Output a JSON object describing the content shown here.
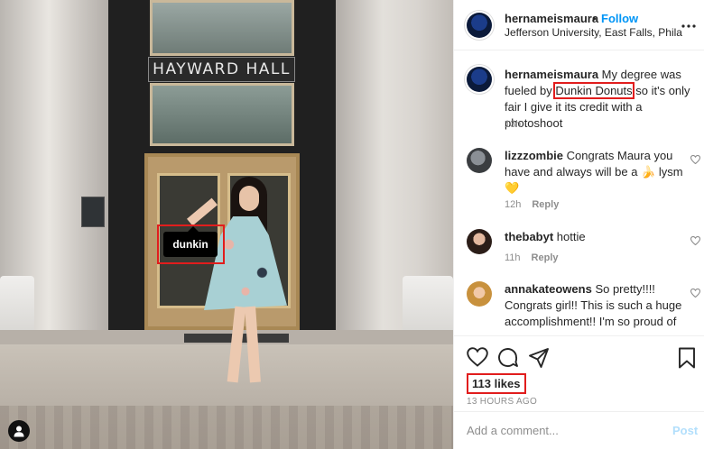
{
  "photo": {
    "building_sign": "HAYWARD HALL",
    "tag_label": "dunkin"
  },
  "header": {
    "username": "hernameismaura",
    "separator": "•",
    "follow_label": "Follow",
    "location": "Jefferson University, East Falls, Phila",
    "more_icon": "more-horizontal-icon"
  },
  "comments": [
    {
      "username": "hernameismaura",
      "text_before": " My degree was fueled by ",
      "mention": "Dunkin Donuts",
      "text_after": " so it's only fair I give it its credit with a photoshoot",
      "time": "13h"
    },
    {
      "username": "lizzzombie",
      "text": " Congrats Maura you have and always will be a 🍌 lysm 💛",
      "time": "12h",
      "reply": "Reply"
    },
    {
      "username": "thebabyt",
      "text": " hottie",
      "time": "11h",
      "reply": "Reply"
    },
    {
      "username": "annakateowens",
      "text": " So pretty!!!! Congrats girl!! This is such a huge accomplishment!! I'm so proud of you!!",
      "time": "",
      "reply": ""
    }
  ],
  "actions": {
    "likes": "113 likes",
    "posted_ago": "13 HOURS AGO",
    "icons": [
      "heart-icon",
      "comment-icon",
      "share-icon",
      "bookmark-icon"
    ]
  },
  "add_comment": {
    "placeholder": "Add a comment...",
    "post_label": "Post"
  },
  "colors": {
    "accent_blue": "#0095f6",
    "highlight_red": "#e11d1d",
    "post_disabled": "#b2dffc"
  }
}
